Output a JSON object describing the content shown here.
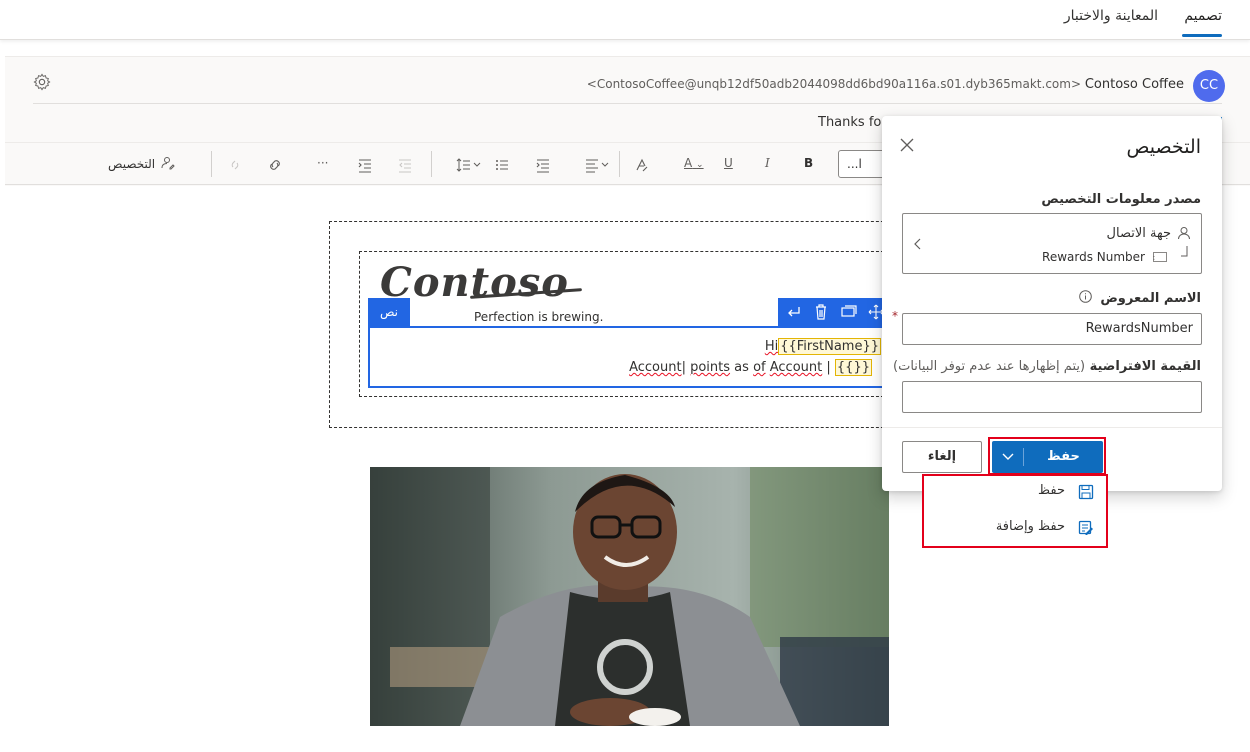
{
  "tabs": [
    {
      "label": "تصميم",
      "active": true
    },
    {
      "label": "المعاينة والاختبار",
      "active": false
    }
  ],
  "header": {
    "avatar_initials": "CC",
    "sender_name": "Contoso Coffee",
    "sender_email": "<ContosoCoffee@unqb12df50adb2044098dd6bd90a116a.s01.dyb365makt.com>",
    "subject_preview": "Thanks for"
  },
  "toolbar": {
    "personalize_label": "التخصيص",
    "font_value": "...l",
    "bold": "B",
    "italic": "I",
    "underline": "U",
    "font_color": "A",
    "more": "···"
  },
  "canvas": {
    "logo_text": "Contoso",
    "tagline": "Perfection is brewing.",
    "block_badge": "نص",
    "greeting": "Hi",
    "token_firstname": "{{FirstName}}",
    "line2_text1": "Account",
    "line2_text2": "points",
    "line2_text3": "as",
    "line2_text4": "of",
    "line2_text5": "Account",
    "line2_sep": "|",
    "token_empty": "{{}}"
  },
  "panel": {
    "title": "التخصيص",
    "source_label": "مصدر معلومات التخصيص",
    "source_entity": "جهة الاتصال",
    "source_attribute": "Rewards Number",
    "display_name_label": "الاسم المعروض",
    "display_name_value": "RewardsNumber",
    "default_value_label": "القيمة الافتراضية",
    "default_value_hint": "(يتم إظهارها عند عدم توفر البيانات)",
    "default_value": "",
    "save_label": "حفظ",
    "cancel_label": "إلغاء"
  },
  "save_menu": [
    {
      "label": "حفظ",
      "icon": "save-icon"
    },
    {
      "label": "حفظ وإضافة",
      "icon": "save-and-add-icon"
    }
  ],
  "colors": {
    "accent": "#0f6cbd",
    "highlight": "#e3001b",
    "token_bg": "#fff8d6"
  }
}
